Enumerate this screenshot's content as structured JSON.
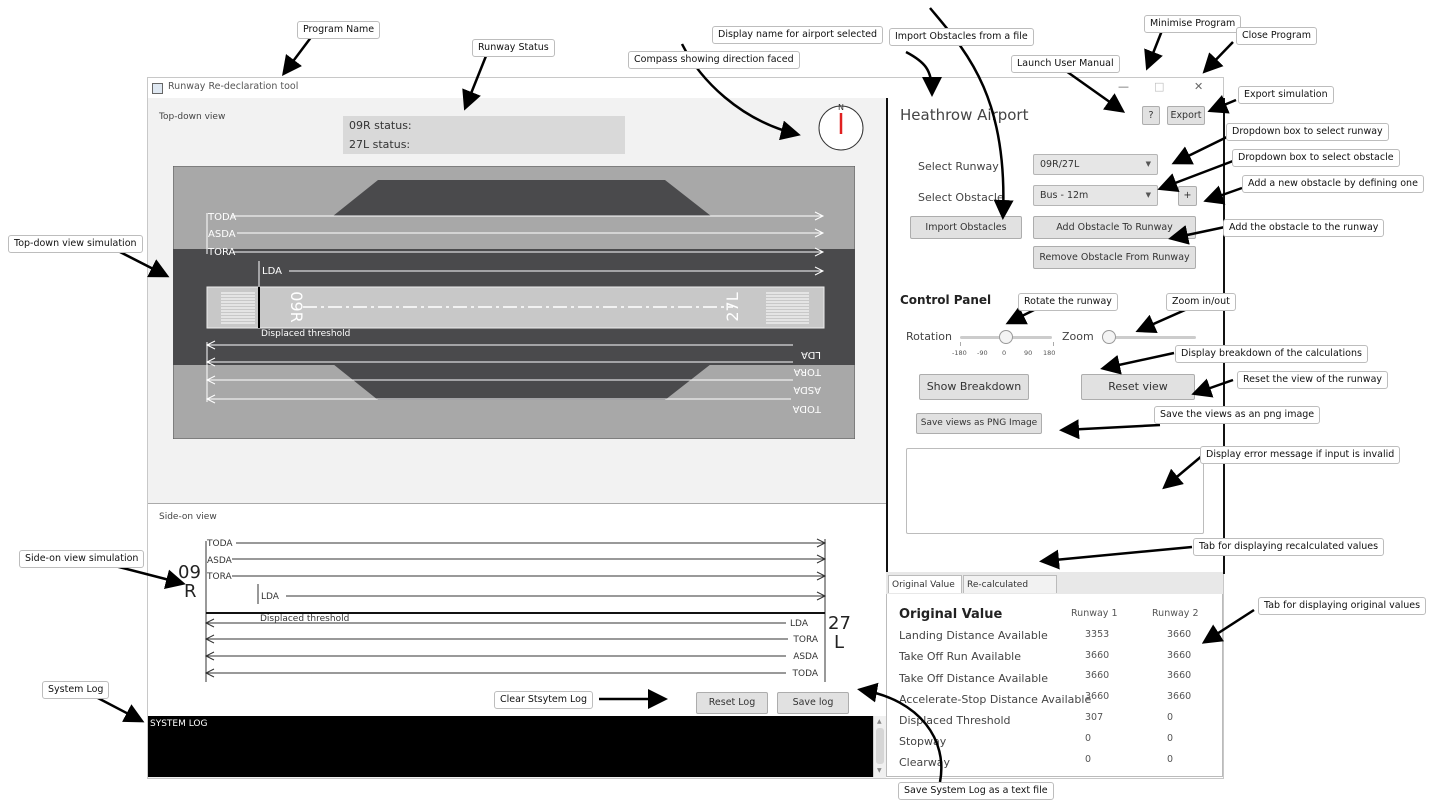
{
  "window": {
    "title": "Runway Re-declaration tool",
    "min": "—",
    "max": "□",
    "close": "✕"
  },
  "top_view": {
    "label": "Top-down view",
    "status_09R": "09R status:",
    "status_27L": "27L status:",
    "compass_letter": "N",
    "top_lines": [
      "TODA",
      "ASDA",
      "TORA",
      "LDA"
    ],
    "bottom_lines": [
      "LDA",
      "TORA",
      "ASDA",
      "TODA"
    ],
    "displaced_threshold": "Displaced threshold",
    "left_marking": "09R",
    "right_marking": "27L"
  },
  "side_view": {
    "label": "Side-on view",
    "top_lines": [
      "TODA",
      "ASDA",
      "TORA",
      "LDA"
    ],
    "bottom_lines": [
      "LDA",
      "TORA",
      "ASDA",
      "TODA"
    ],
    "displaced_threshold": "Displaced threshold",
    "left_id_top": "09",
    "left_id_bottom": "R",
    "right_id_top": "27",
    "right_id_bottom": "L",
    "reset_log": "Reset Log",
    "save_log": "Save log"
  },
  "system_log": {
    "title": "SYSTEM LOG"
  },
  "right_panel": {
    "airport_name": "Heathrow Airport",
    "help_button": "?",
    "export_button": "Export",
    "select_runway_label": "Select Runway",
    "runway_value": "09R/27L",
    "select_obstacle_label": "Select Obstacle",
    "obstacle_value": "Bus - 12m",
    "add_new_obstacle": "+",
    "import_obstacles": "Import Obstacles",
    "add_obstacle": "Add Obstacle To Runway",
    "remove_obstacle": "Remove Obstacle From Runway",
    "control_panel_title": "Control Panel",
    "rotation_label": "Rotation",
    "rotation_ticks": [
      "-180",
      "-90",
      "0",
      "90",
      "180"
    ],
    "rotation_value": 0,
    "zoom_label": "Zoom",
    "zoom_value": 0,
    "show_breakdown": "Show Breakdown",
    "reset_view": "Reset view",
    "save_png": "Save views as PNG Image",
    "tabs": [
      "Original Value",
      "Re-calculated Value"
    ],
    "table_title": "Original Value",
    "col1": "Runway 1",
    "col2": "Runway 2",
    "rows": [
      {
        "label": "Landing Distance Available",
        "r1": "3353",
        "r2": "3660"
      },
      {
        "label": "Take Off Run Available",
        "r1": "3660",
        "r2": "3660"
      },
      {
        "label": "Take Off Distance Available",
        "r1": "3660",
        "r2": "3660"
      },
      {
        "label": "Accelerate-Stop Distance Available",
        "r1": "3660",
        "r2": "3660"
      },
      {
        "label": "Displaced Threshold",
        "r1": "307",
        "r2": "0"
      },
      {
        "label": "Stopway",
        "r1": "0",
        "r2": "0"
      },
      {
        "label": "Clearway",
        "r1": "0",
        "r2": "0"
      }
    ]
  },
  "annotations": {
    "program_name": "Program Name",
    "runway_status": "Runway Status",
    "display_name": "Display name for airport selected",
    "import_obstacles_file": "Import Obstacles from a file",
    "minimise": "Minimise Program",
    "close": "Close Program",
    "compass": "Compass showing direction faced",
    "user_manual": "Launch User Manual",
    "export_sim": "Export simulation",
    "dropdown_runway": "Dropdown box to select runway",
    "dropdown_obstacle": "Dropdown box to select obstacle",
    "add_new_obstacle": "Add a new obstacle by defining one",
    "add_obstacle_runway": "Add the obstacle to the runway",
    "top_down_sim": "Top-down view simulation",
    "rotate": "Rotate the runway",
    "zoom": "Zoom in/out",
    "breakdown": "Display breakdown of the calculations",
    "reset_view": "Reset the view of the runway",
    "save_png": "Save the views as an png image",
    "error_msg": "Display error message if input is invalid",
    "tab_recalc": "Tab for displaying recalculated values",
    "side_on_sim": "Side-on view simulation",
    "tab_original": "Tab for displaying original values",
    "system_log": "System Log",
    "clear_log": "Clear Stsytem Log",
    "save_log_text": "Save System Log as a text file"
  },
  "colors": {
    "annotation_arrow": "#000000",
    "compass_needle": "#e02020",
    "runway_grey": "#c8c8c8",
    "strip_dark": "#4a4a4c",
    "graded_area": "#a8a8a8"
  }
}
